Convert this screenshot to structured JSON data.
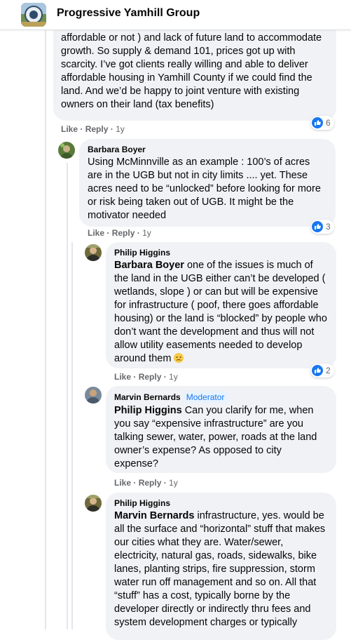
{
  "group": {
    "name": "Progressive Yamhill Group"
  },
  "actions": {
    "like": "Like",
    "reply": "Reply",
    "sep": "·"
  },
  "comments": [
    {
      "text": "affordable or not ) and lack of future land to accommodate growth. So supply & demand 101, prices got up with scarcity. I’ve got clients really willing and able to deliver affordable housing in Yamhill County if we could find the land. And we’d be happy to joint venture with existing owners on their land (tax benefits)",
      "time": "1y",
      "likes": "6"
    },
    {
      "author": "Barbara Boyer",
      "text": "Using McMinnville as an example : 100’s of acres are in the UGB but not in city limits .... yet. These acres need to be “unlocked” before looking for more or risk being taken out of UGB. It might be the motivator needed",
      "time": "1y",
      "likes": "3"
    },
    {
      "author": "Philip Higgins",
      "mention": "Barbara Boyer",
      "text": " one of the issues is much of the land in the UGB either can’t be developed ( wetlands, slope ) or can but will be expensive for infrastructure ( poof, there goes affordable housing) or the land is “blocked” by people who don’t want the development and thus will not allow utility easements needed to develop around them ",
      "emoji": "disappointed-face",
      "time": "1y",
      "likes": "2"
    },
    {
      "author": "Marvin Bernards",
      "badge": "Moderator",
      "mention": "Philip Higgins",
      "text": " Can you clarify for me, when you say “expensive infrastructure” are you talking sewer, water, power, roads at the land owner’s expense? As opposed to city expense?",
      "time": "1y"
    },
    {
      "author": "Philip Higgins",
      "mention": "Marvin Bernards",
      "text": " infrastructure, yes. would be all the surface and “horizontal” stuff that makes our cities what they are. Water/sewer, electricity, natural gas, roads, sidewalks, bike lanes, planting strips, fire suppression, storm water run off management and so on. All that “stuff” has a cost, typically borne by the developer directly or indirectly thru fees and system development charges or typically"
    }
  ],
  "colors": {
    "bubble": "#f0f2f5",
    "like": "#1877f2",
    "meta": "#65676b",
    "badge_bg": "#e7f3ff"
  }
}
